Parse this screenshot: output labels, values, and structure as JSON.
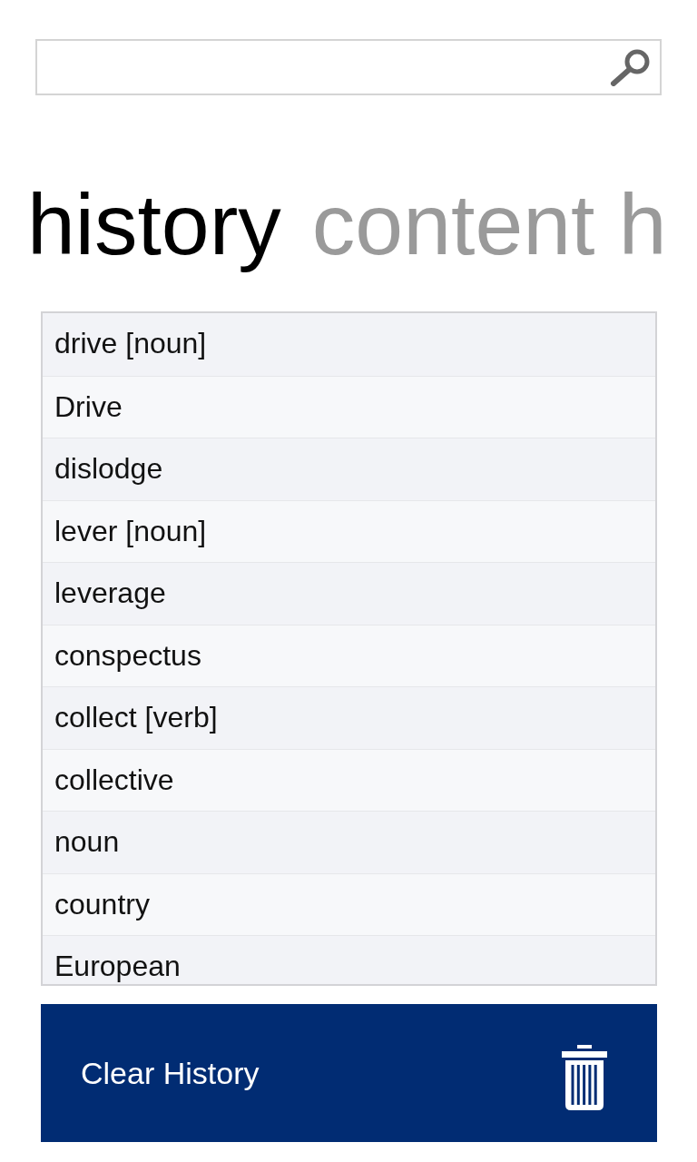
{
  "pivot": {
    "tabs": [
      {
        "label": "history",
        "selected": true
      },
      {
        "label": "content h",
        "selected": false
      }
    ]
  },
  "history_list": {
    "items": [
      "drive [noun]",
      "Drive",
      "dislodge",
      "lever [noun]",
      "leverage",
      "conspectus",
      "collect [verb]",
      "collective",
      "noun",
      "country",
      "European"
    ]
  },
  "clear_button": {
    "label": "Clear History"
  }
}
